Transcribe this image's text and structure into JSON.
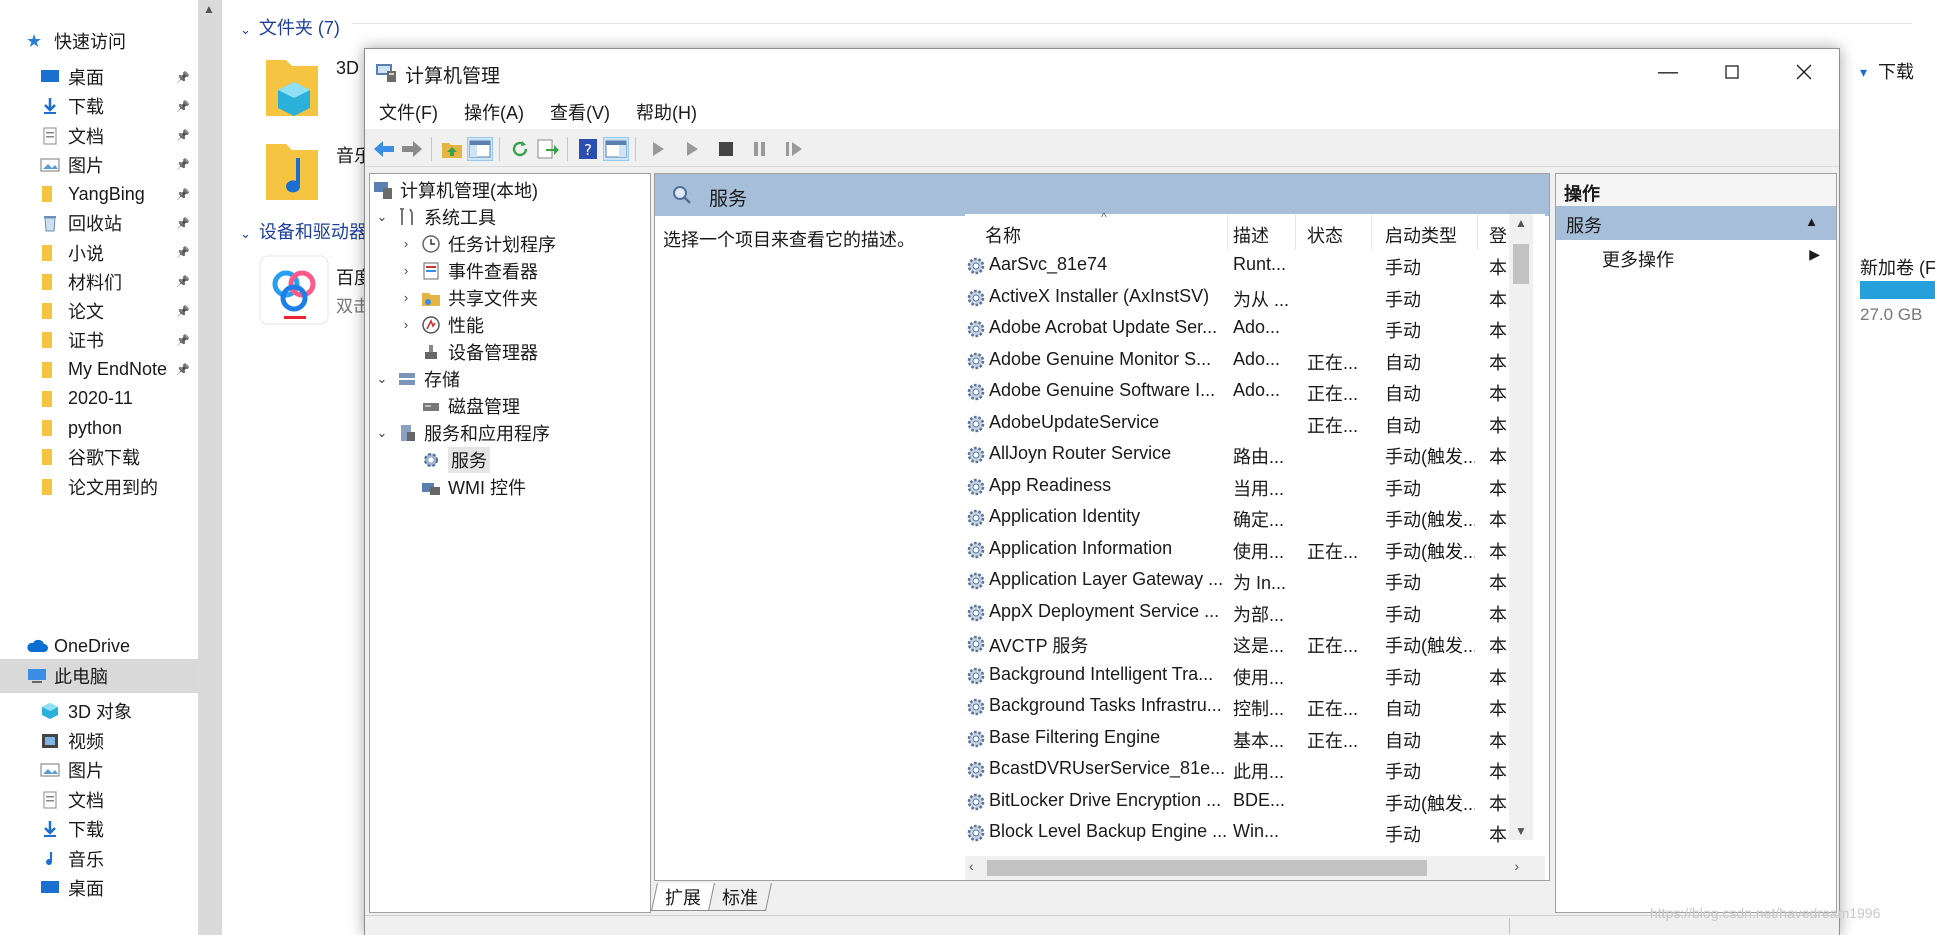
{
  "explorer": {
    "nav": {
      "quick_access": "快速访问",
      "items": [
        {
          "label": "桌面",
          "pinned": true
        },
        {
          "label": "下载",
          "pinned": true
        },
        {
          "label": "文档",
          "pinned": true
        },
        {
          "label": "图片",
          "pinned": true
        },
        {
          "label": "YangBing",
          "pinned": true
        },
        {
          "label": "回收站",
          "pinned": true
        },
        {
          "label": "小说",
          "pinned": true
        },
        {
          "label": "材料们",
          "pinned": true
        },
        {
          "label": "论文",
          "pinned": true
        },
        {
          "label": "证书",
          "pinned": true
        },
        {
          "label": "My EndNote",
          "pinned": true
        },
        {
          "label": "2020-11",
          "pinned": false
        },
        {
          "label": "python",
          "pinned": false
        },
        {
          "label": "谷歌下载",
          "pinned": false
        },
        {
          "label": "论文用到的",
          "pinned": false
        }
      ],
      "onedrive": "OneDrive",
      "this_pc": "此电脑",
      "pc_items": [
        "3D 对象",
        "视频",
        "图片",
        "文档",
        "下载",
        "音乐",
        "桌面"
      ]
    },
    "content": {
      "folders_header": "文件夹 (7)",
      "folder_3d": "3D",
      "folder_music": "音乐",
      "folder_download": "下载",
      "drives_header": "设备和驱动器",
      "baidu_title": "百度",
      "baidu_sub": "双击",
      "new_volume": "新加卷 (F",
      "new_volume_free": "27.0 GB"
    }
  },
  "window": {
    "title": "计算机管理",
    "menu": [
      "文件(F)",
      "操作(A)",
      "查看(V)",
      "帮助(H)"
    ],
    "tree": {
      "root": "计算机管理(本地)",
      "system_tools": "系统工具",
      "task_scheduler": "任务计划程序",
      "event_viewer": "事件查看器",
      "shared_folders": "共享文件夹",
      "performance": "性能",
      "device_manager": "设备管理器",
      "storage": "存储",
      "disk_management": "磁盘管理",
      "services_apps": "服务和应用程序",
      "services": "服务",
      "wmi": "WMI 控件"
    },
    "center": {
      "header": "服务",
      "description_hint": "选择一个项目来查看它的描述。",
      "columns": [
        "名称",
        "描述",
        "状态",
        "启动类型",
        "登"
      ],
      "rows": [
        {
          "name": "AarSvc_81e74",
          "desc": "Runt...",
          "status": "",
          "startup": "手动",
          "logon": "本"
        },
        {
          "name": "ActiveX Installer (AxInstSV)",
          "desc": "为从 ...",
          "status": "",
          "startup": "手动",
          "logon": "本"
        },
        {
          "name": "Adobe Acrobat Update Ser...",
          "desc": "Ado...",
          "status": "",
          "startup": "手动",
          "logon": "本"
        },
        {
          "name": "Adobe Genuine Monitor S...",
          "desc": "Ado...",
          "status": "正在...",
          "startup": "自动",
          "logon": "本"
        },
        {
          "name": "Adobe Genuine Software I...",
          "desc": "Ado...",
          "status": "正在...",
          "startup": "自动",
          "logon": "本"
        },
        {
          "name": "AdobeUpdateService",
          "desc": "",
          "status": "正在...",
          "startup": "自动",
          "logon": "本"
        },
        {
          "name": "AllJoyn Router Service",
          "desc": "路由...",
          "status": "",
          "startup": "手动(触发...",
          "logon": "本"
        },
        {
          "name": "App Readiness",
          "desc": "当用...",
          "status": "",
          "startup": "手动",
          "logon": "本"
        },
        {
          "name": "Application Identity",
          "desc": "确定...",
          "status": "",
          "startup": "手动(触发...",
          "logon": "本"
        },
        {
          "name": "Application Information",
          "desc": "使用...",
          "status": "正在...",
          "startup": "手动(触发...",
          "logon": "本"
        },
        {
          "name": "Application Layer Gateway ...",
          "desc": "为 In...",
          "status": "",
          "startup": "手动",
          "logon": "本"
        },
        {
          "name": "AppX Deployment Service ...",
          "desc": "为部...",
          "status": "",
          "startup": "手动",
          "logon": "本"
        },
        {
          "name": "AVCTP 服务",
          "desc": "这是...",
          "status": "正在...",
          "startup": "手动(触发...",
          "logon": "本"
        },
        {
          "name": "Background Intelligent Tra...",
          "desc": "使用...",
          "status": "",
          "startup": "手动",
          "logon": "本"
        },
        {
          "name": "Background Tasks Infrastru...",
          "desc": "控制...",
          "status": "正在...",
          "startup": "自动",
          "logon": "本"
        },
        {
          "name": "Base Filtering Engine",
          "desc": "基本...",
          "status": "正在...",
          "startup": "自动",
          "logon": "本"
        },
        {
          "name": "BcastDVRUserService_81e...",
          "desc": "此用...",
          "status": "",
          "startup": "手动",
          "logon": "本"
        },
        {
          "name": "BitLocker Drive Encryption ...",
          "desc": "BDE...",
          "status": "",
          "startup": "手动(触发...",
          "logon": "本"
        },
        {
          "name": "Block Level Backup Engine ...",
          "desc": "Win...",
          "status": "",
          "startup": "手动",
          "logon": "本"
        }
      ],
      "tabs": [
        "扩展",
        "标准"
      ]
    },
    "actions": {
      "title": "操作",
      "selected": "服务",
      "more": "更多操作"
    }
  },
  "watermark": "https://blog.csdn.net/havedream1996",
  "colors": {
    "pane_header": "#a7bed8",
    "link_blue": "#1e3f9c",
    "folder": "#f5c542"
  }
}
